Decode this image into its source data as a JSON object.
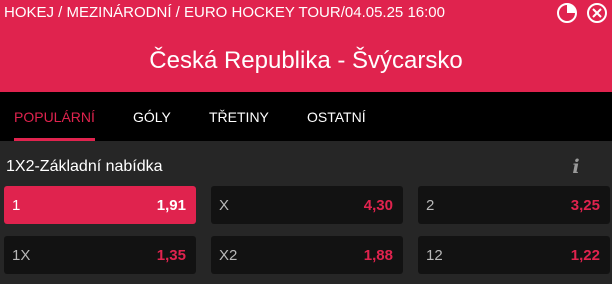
{
  "header": {
    "breadcrumb": "HOKEJ / MEZINÁRODNÍ / EURO HOCKEY TOUR/04.05.25 16:00",
    "match_title": "Česká Republika - Švýcarsko",
    "stats_icon": "pie-chart-icon",
    "close_icon": "circle-x-icon"
  },
  "tabs": [
    {
      "label": "POPULÁRNÍ",
      "active": true
    },
    {
      "label": "GÓLY",
      "active": false
    },
    {
      "label": "TŘETINY",
      "active": false
    },
    {
      "label": "OSTATNÍ",
      "active": false
    }
  ],
  "market": {
    "title": "1X2-Základní nabídka",
    "info_icon": "info-icon",
    "odds": [
      {
        "label": "1",
        "value": "1,91",
        "selected": true
      },
      {
        "label": "X",
        "value": "4,30",
        "selected": false
      },
      {
        "label": "2",
        "value": "3,25",
        "selected": false
      },
      {
        "label": "1X",
        "value": "1,35",
        "selected": false
      },
      {
        "label": "X2",
        "value": "1,88",
        "selected": false
      },
      {
        "label": "12",
        "value": "1,22",
        "selected": false
      }
    ]
  },
  "colors": {
    "accent": "#e0234e",
    "background": "#262626",
    "tab_bar": "#000000",
    "odds_button": "#121212"
  }
}
